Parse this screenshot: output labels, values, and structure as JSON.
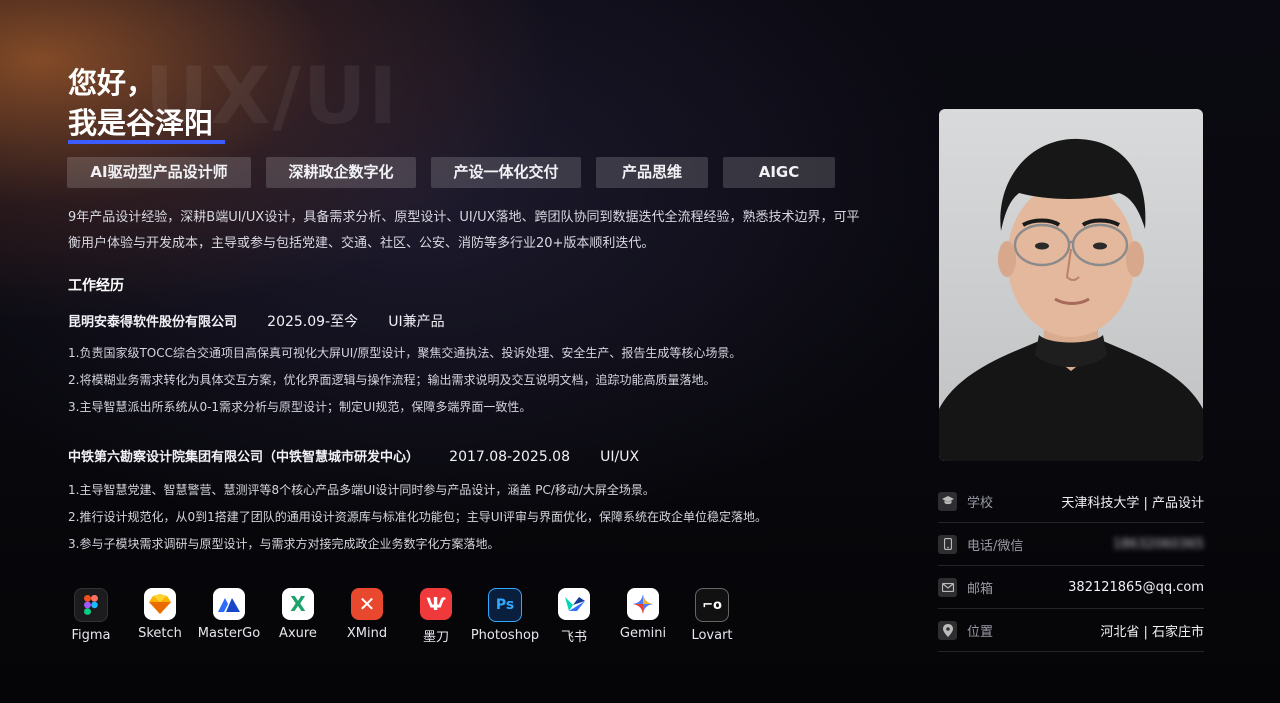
{
  "hero": {
    "watermark": "UX/UI",
    "greeting": "您好，",
    "name": "我是谷泽阳"
  },
  "tags": [
    {
      "label": "AI驱动型产品设计师"
    },
    {
      "label": "深耕政企数字化"
    },
    {
      "label": "产设一体化交付"
    },
    {
      "label": "产品思维"
    },
    {
      "label": "AIGC"
    }
  ],
  "intro": "9年产品设计经验，深耕B端UI/UX设计，具备需求分析、原型设计、UI/UX落地、跨团队协同到数据迭代全流程经验，熟悉技术边界，可平衡用户体验与开发成本，主导或参与包括党建、交通、社区、公安、消防等多行业20+版本顺利迭代。",
  "experience": {
    "title": "工作经历",
    "jobs": [
      {
        "company": "昆明安泰得软件股份有限公司",
        "period": "2025.09-至今",
        "role": "UI兼产品",
        "bullets": [
          "1.负责国家级TOCC综合交通项目高保真可视化大屏UI/原型设计，聚焦交通执法、投诉处理、安全生产、报告生成等核心场景。",
          "2.将模糊业务需求转化为具体交互方案，优化界面逻辑与操作流程；输出需求说明及交互说明文档，追踪功能高质量落地。",
          "3.主导智慧派出所系统从0-1需求分析与原型设计；制定UI规范，保障多端界面一致性。"
        ]
      },
      {
        "company": "中铁第六勘察设计院集团有限公司（中铁智慧城市研发中心）",
        "period": "2017.08-2025.08",
        "role": "UI/UX",
        "bullets": [
          "1.主导智慧党建、智慧警营、慧测评等8个核心产品多端UI设计同时参与产品设计，涵盖 PC/移动/大屏全场景。",
          "2.推行设计规范化，从0到1搭建了团队的通用设计资源库与标准化功能包；主导UI评审与界面优化，保障系统在政企单位稳定落地。",
          "3.参与子模块需求调研与原型设计，与需求方对接完成政企业务数字化方案落地。"
        ]
      }
    ]
  },
  "tools": [
    {
      "name": "Figma",
      "icon": "figma-icon"
    },
    {
      "name": "Sketch",
      "icon": "sketch-icon"
    },
    {
      "name": "MasterGo",
      "icon": "mastergo-icon"
    },
    {
      "name": "Axure",
      "icon": "axure-icon"
    },
    {
      "name": "XMind",
      "icon": "xmind-icon"
    },
    {
      "name": "墨刀",
      "icon": "modao-icon"
    },
    {
      "name": "Photoshop",
      "icon": "photoshop-icon"
    },
    {
      "name": "飞书",
      "icon": "feishu-icon"
    },
    {
      "name": "Gemini",
      "icon": "gemini-icon"
    },
    {
      "name": "Lovart",
      "icon": "lovart-icon"
    }
  ],
  "contact": {
    "school_label": "学校",
    "school_value": "天津科技大学 | 产品设计",
    "phone_label": "电话/微信",
    "phone_value": "18632060365",
    "email_label": "邮箱",
    "email_value": "382121865@qq.com",
    "location_label": "位置",
    "location_value": "河北省 | 石家庄市"
  },
  "colors": {
    "accent_underline": "#3d5cff",
    "tag_bg": "rgba(255,255,255,0.16)"
  }
}
